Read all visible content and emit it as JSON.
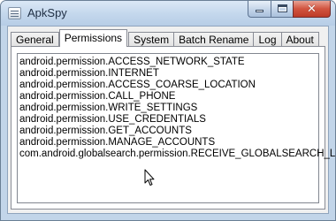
{
  "window": {
    "title": "ApkSpy",
    "icon": "app-window-icon",
    "controls": {
      "minimize": "minimize-icon",
      "maximize": "maximize-icon",
      "close": "close-icon",
      "close_glyph": "✕"
    }
  },
  "tabs": [
    {
      "label": "General",
      "active": false
    },
    {
      "label": "Permissions",
      "active": true
    },
    {
      "label": "System",
      "active": false
    },
    {
      "label": "Batch Rename",
      "active": false
    },
    {
      "label": "Log",
      "active": false
    },
    {
      "label": "About",
      "active": false
    }
  ],
  "permissions": [
    "android.permission.ACCESS_NETWORK_STATE",
    "android.permission.INTERNET",
    "android.permission.ACCESS_COARSE_LOCATION",
    "android.permission.CALL_PHONE",
    "android.permission.WRITE_SETTINGS",
    "android.permission.USE_CREDENTIALS",
    "android.permission.GET_ACCOUNTS",
    "android.permission.MANAGE_ACCOUNTS",
    "com.android.globalsearch.permission.RECEIVE_GLOBALSEARCH_LOG"
  ],
  "colors": {
    "titlebar": "#c5d8ed",
    "close_button": "#d1543f",
    "client_background": "#f0f0f0",
    "panel_background": "#ffffff"
  }
}
